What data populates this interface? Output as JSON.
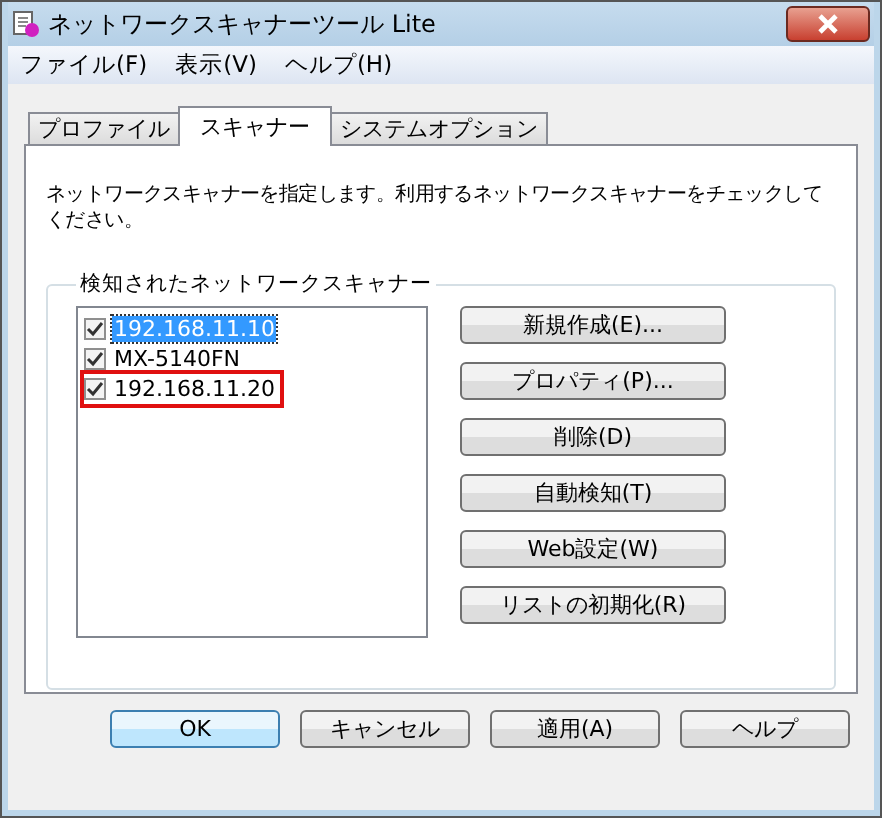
{
  "window": {
    "title": "ネットワークスキャナーツール Lite"
  },
  "menu": [
    "ファイル(F)",
    "表示(V)",
    "ヘルプ(H)"
  ],
  "tabs": [
    {
      "label": "プロファイル",
      "selected": false
    },
    {
      "label": "スキャナー",
      "selected": true
    },
    {
      "label": "システムオプション",
      "selected": false
    }
  ],
  "description": "ネットワークスキャナーを指定します。利用するネットワークスキャナーをチェックしてください。",
  "group": {
    "title": "検知されたネットワークスキャナー",
    "scanners": [
      {
        "name": "192.168.11.10",
        "checked": true,
        "selected": true,
        "highlighted": false
      },
      {
        "name": "MX-5140FN",
        "checked": true,
        "selected": false,
        "highlighted": false
      },
      {
        "name": "192.168.11.20",
        "checked": true,
        "selected": false,
        "highlighted": true
      }
    ],
    "buttons": [
      "新規作成(E)...",
      "プロパティ(P)...",
      "削除(D)",
      "自動検知(T)",
      "Web設定(W)",
      "リストの初期化(R)"
    ]
  },
  "footer_buttons": [
    {
      "label": "OK",
      "default": true
    },
    {
      "label": "キャンセル",
      "default": false
    },
    {
      "label": "適用(A)",
      "default": false
    },
    {
      "label": "ヘルプ",
      "default": false
    }
  ]
}
